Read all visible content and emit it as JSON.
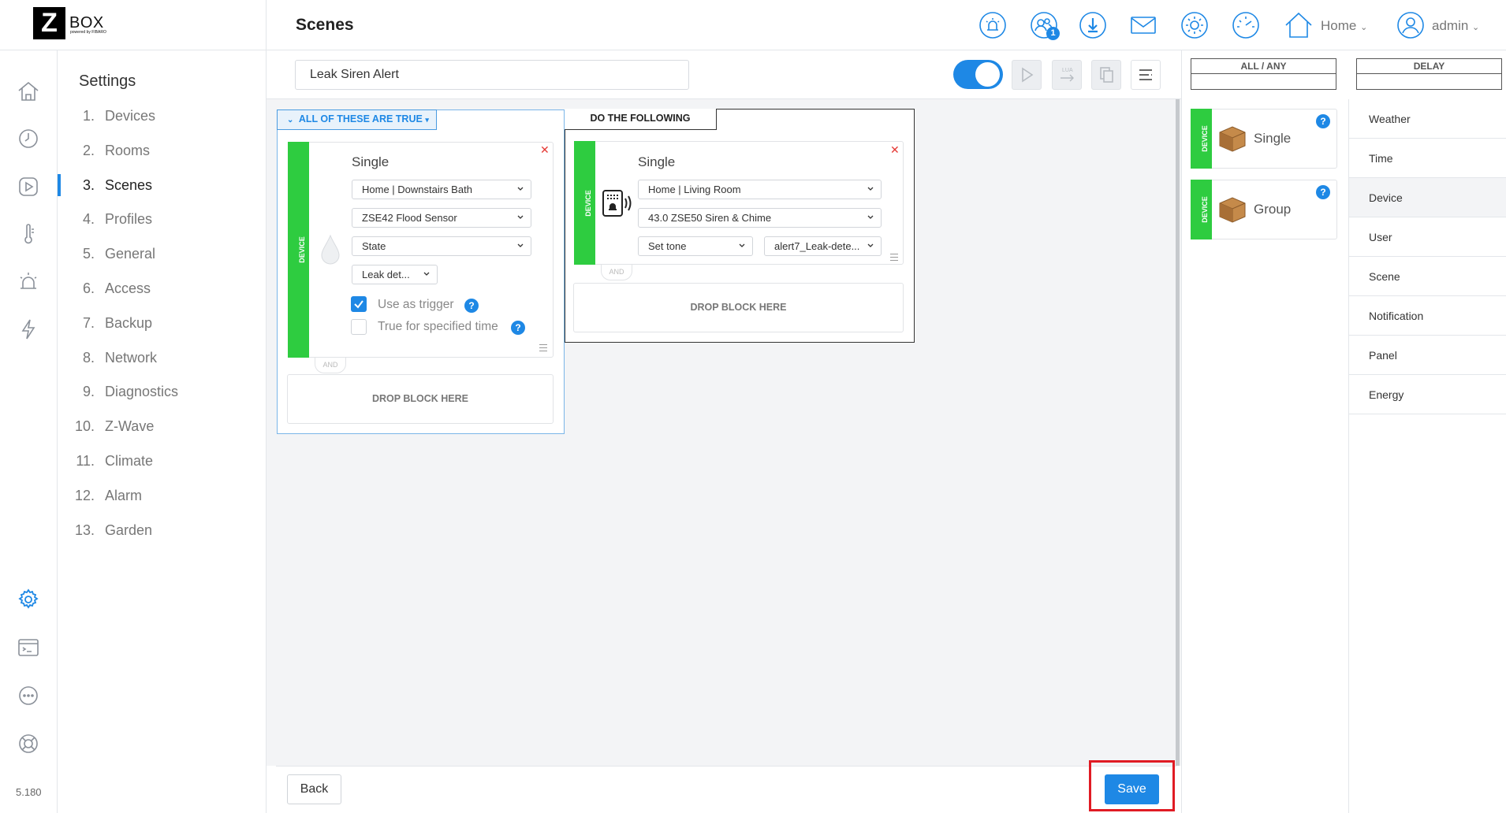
{
  "header": {
    "logo_letter": "Z",
    "logo_text": "BOX",
    "logo_sub": "powered by FIBARO",
    "page_title": "Scenes",
    "notification_count": "1",
    "home_label": "Home",
    "user_label": "admin"
  },
  "sidebar": {
    "version": "5.180",
    "title": "Settings",
    "items": [
      {
        "num": "1.",
        "label": "Devices"
      },
      {
        "num": "2.",
        "label": "Rooms"
      },
      {
        "num": "3.",
        "label": "Scenes"
      },
      {
        "num": "4.",
        "label": "Profiles"
      },
      {
        "num": "5.",
        "label": "General"
      },
      {
        "num": "6.",
        "label": "Access"
      },
      {
        "num": "7.",
        "label": "Backup"
      },
      {
        "num": "8.",
        "label": "Network"
      },
      {
        "num": "9.",
        "label": "Diagnostics"
      },
      {
        "num": "10.",
        "label": "Z-Wave"
      },
      {
        "num": "11.",
        "label": "Climate"
      },
      {
        "num": "12.",
        "label": "Alarm"
      },
      {
        "num": "13.",
        "label": "Garden"
      }
    ],
    "active_index": 2
  },
  "scene": {
    "name": "Leak Siren Alert",
    "enabled": true,
    "conditions_header": "ALL OF THESE ARE TRUE",
    "actions_header": "DO THE FOLLOWING",
    "condition_block": {
      "strip_label": "DEVICE",
      "title": "Single",
      "room": "Home | Downstairs Bath",
      "device": "ZSE42 Flood Sensor",
      "property": "State",
      "value": "Leak det...",
      "use_as_trigger_label": "Use as trigger",
      "use_as_trigger": true,
      "true_for_time_label": "True for specified time",
      "true_for_time": false
    },
    "action_block": {
      "strip_label": "DEVICE",
      "title": "Single",
      "room": "Home | Living Room",
      "device": "43.0 ZSE50 Siren & Chime",
      "action": "Set tone",
      "tone": "alert7_Leak-dete..."
    },
    "and_label": "AND",
    "drop_label": "DROP BLOCK HERE"
  },
  "buttons": {
    "back": "Back",
    "save": "Save"
  },
  "right_panel": {
    "tabs": [
      "ALL / ANY",
      "DELAY"
    ],
    "cards": [
      {
        "strip": "DEVICE",
        "label": "Single"
      },
      {
        "strip": "DEVICE",
        "label": "Group"
      }
    ],
    "categories": [
      "Weather",
      "Time",
      "Device",
      "User",
      "Scene",
      "Notification",
      "Panel",
      "Energy"
    ],
    "active_category": "Device"
  },
  "colors": {
    "accent": "#1e88e5",
    "device_green": "#2ecc40",
    "highlight_red": "#e01b24"
  }
}
